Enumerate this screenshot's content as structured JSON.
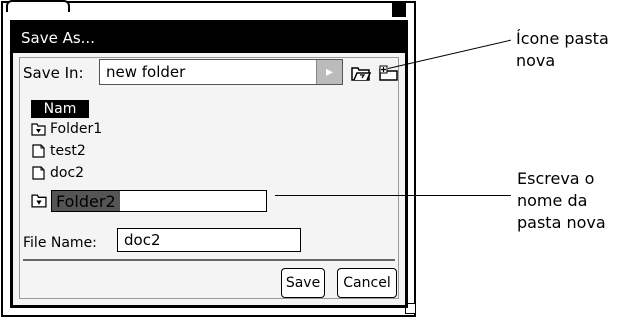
{
  "dialog": {
    "title": "Save As...",
    "save_in_label": "Save In:",
    "save_in_value": "new folder",
    "dropdown_glyph": "▸",
    "column_header": "Nam",
    "items": [
      {
        "name": "Folder1",
        "icon": "folder-icon"
      },
      {
        "name": "test2",
        "icon": "document-icon"
      },
      {
        "name": "doc2",
        "icon": "document-icon"
      }
    ],
    "rename_value": "Folder2",
    "file_name_label": "File Name:",
    "file_name_value": "doc2",
    "save_label": "Save",
    "cancel_label": "Cancel"
  },
  "callouts": {
    "new_folder": "Ícone pasta\nnova",
    "rename": "Escreva o\nnome da\npasta nova"
  }
}
